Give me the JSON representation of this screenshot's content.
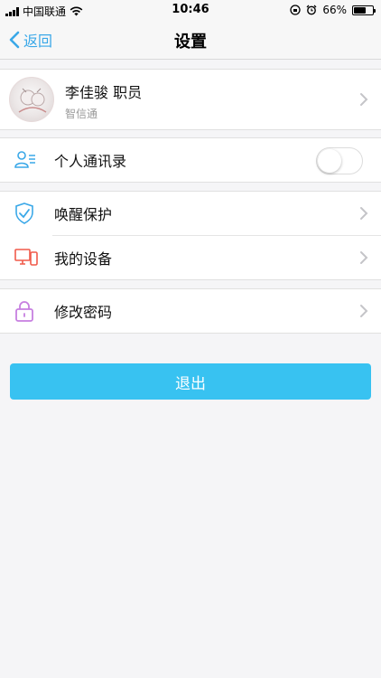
{
  "status_bar": {
    "carrier": "中国联通",
    "time": "10:46",
    "battery_percent": "66%",
    "battery_level": 0.66
  },
  "nav": {
    "back_label": "返回",
    "title": "设置"
  },
  "profile": {
    "name": "李佳骏  职员",
    "org": "智信通"
  },
  "contacts": {
    "label": "个人通讯录",
    "enabled": false
  },
  "security_group": {
    "items": [
      {
        "label": "唤醒保护",
        "icon": "shield-check-icon"
      },
      {
        "label": "我的设备",
        "icon": "devices-icon"
      }
    ]
  },
  "password": {
    "label": "修改密码",
    "icon": "lock-icon"
  },
  "logout": {
    "label": "退出"
  },
  "colors": {
    "accent": "#3aa8e8",
    "logout_bg": "#38c2f1",
    "device_icon": "#f05a4a",
    "lock_icon": "#c77fe0"
  }
}
